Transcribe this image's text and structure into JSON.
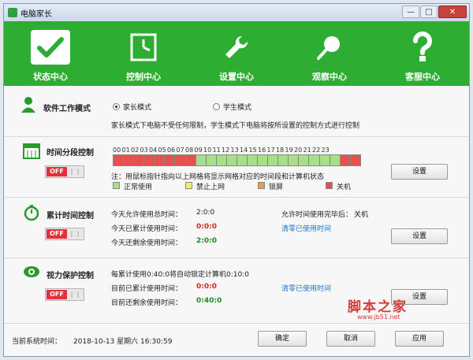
{
  "window": {
    "title": "电脑家长",
    "min": "—",
    "max": "□",
    "close": "✕"
  },
  "toolbar": [
    {
      "label": "状态中心",
      "icon": "checkmark-icon",
      "active": true
    },
    {
      "label": "控制中心",
      "icon": "clock-icon",
      "active": false
    },
    {
      "label": "设置中心",
      "icon": "wrench-icon",
      "active": false
    },
    {
      "label": "观察中心",
      "icon": "magnifier-icon",
      "active": false
    },
    {
      "label": "客服中心",
      "icon": "question-icon",
      "active": false
    }
  ],
  "mode": {
    "title": "软件工作模式",
    "option1": "家长模式",
    "option2": "学生模式",
    "selected": "家长模式",
    "desc": "家长模式下电脑不受任何限制，学生模式下电脑将按所设置的控制方式进行控制"
  },
  "schedule": {
    "title": "时间分段控制",
    "toggle": "OFF",
    "hours": [
      "00",
      "01",
      "02",
      "03",
      "04",
      "05",
      "06",
      "07",
      "08",
      "09",
      "10",
      "11",
      "12",
      "13",
      "14",
      "15",
      "16",
      "17",
      "18",
      "19",
      "20",
      "21",
      "22",
      "23"
    ],
    "states": [
      "off",
      "off",
      "off",
      "off",
      "off",
      "off",
      "off",
      "off",
      "normal",
      "normal",
      "normal",
      "normal",
      "normal",
      "normal",
      "normal",
      "normal",
      "normal",
      "normal",
      "normal",
      "normal",
      "normal",
      "normal",
      "off",
      "off"
    ],
    "hint": "注：用鼠标指针指向以上网格将显示网格对应的时间段和计算机状态",
    "legend": [
      {
        "label": "正常使用",
        "color": "#a8e08a"
      },
      {
        "label": "禁止上网",
        "color": "#f4ef6a"
      },
      {
        "label": "锁屏",
        "color": "#f29a3a"
      },
      {
        "label": "关机",
        "color": "#e85050"
      }
    ],
    "setting": "设置"
  },
  "cumulative": {
    "title": "累计时间控制",
    "toggle": "OFF",
    "today_total_label": "今天允许使用总时间：",
    "today_total": "2:0:0",
    "today_used_label": "今天已累计使用时间：",
    "today_used": "0:0:0",
    "today_left_label": "今天还剩余使用时间：",
    "today_left": "2:0:0",
    "after_label": "允许时间使用完毕后：",
    "after_value": "关机",
    "clear": "清零已使用时间",
    "setting": "设置"
  },
  "vision": {
    "title": "视力保护控制",
    "toggle": "OFF",
    "rule": "每累计使用0:40:0将自动锁定计算机0:10:0",
    "used_label": "目前已累计使用时间：",
    "used": "0:0:0",
    "left_label": "目前还剩余使用时间：",
    "left": "0:40:0",
    "clear": "清零已使用时间",
    "setting": "设置"
  },
  "status": {
    "time_label": "当前系统时间：",
    "time": "2018-10-13  星期六  16:30:59",
    "ok": "确定",
    "cancel": "取消",
    "apply": "应用"
  },
  "watermark": {
    "brand": "脚本之家",
    "url": "www.jb51.net"
  },
  "colors": {
    "green": "#2dae32",
    "red": "#e2313a",
    "normal": "#a8e08a",
    "off": "#e85050"
  }
}
